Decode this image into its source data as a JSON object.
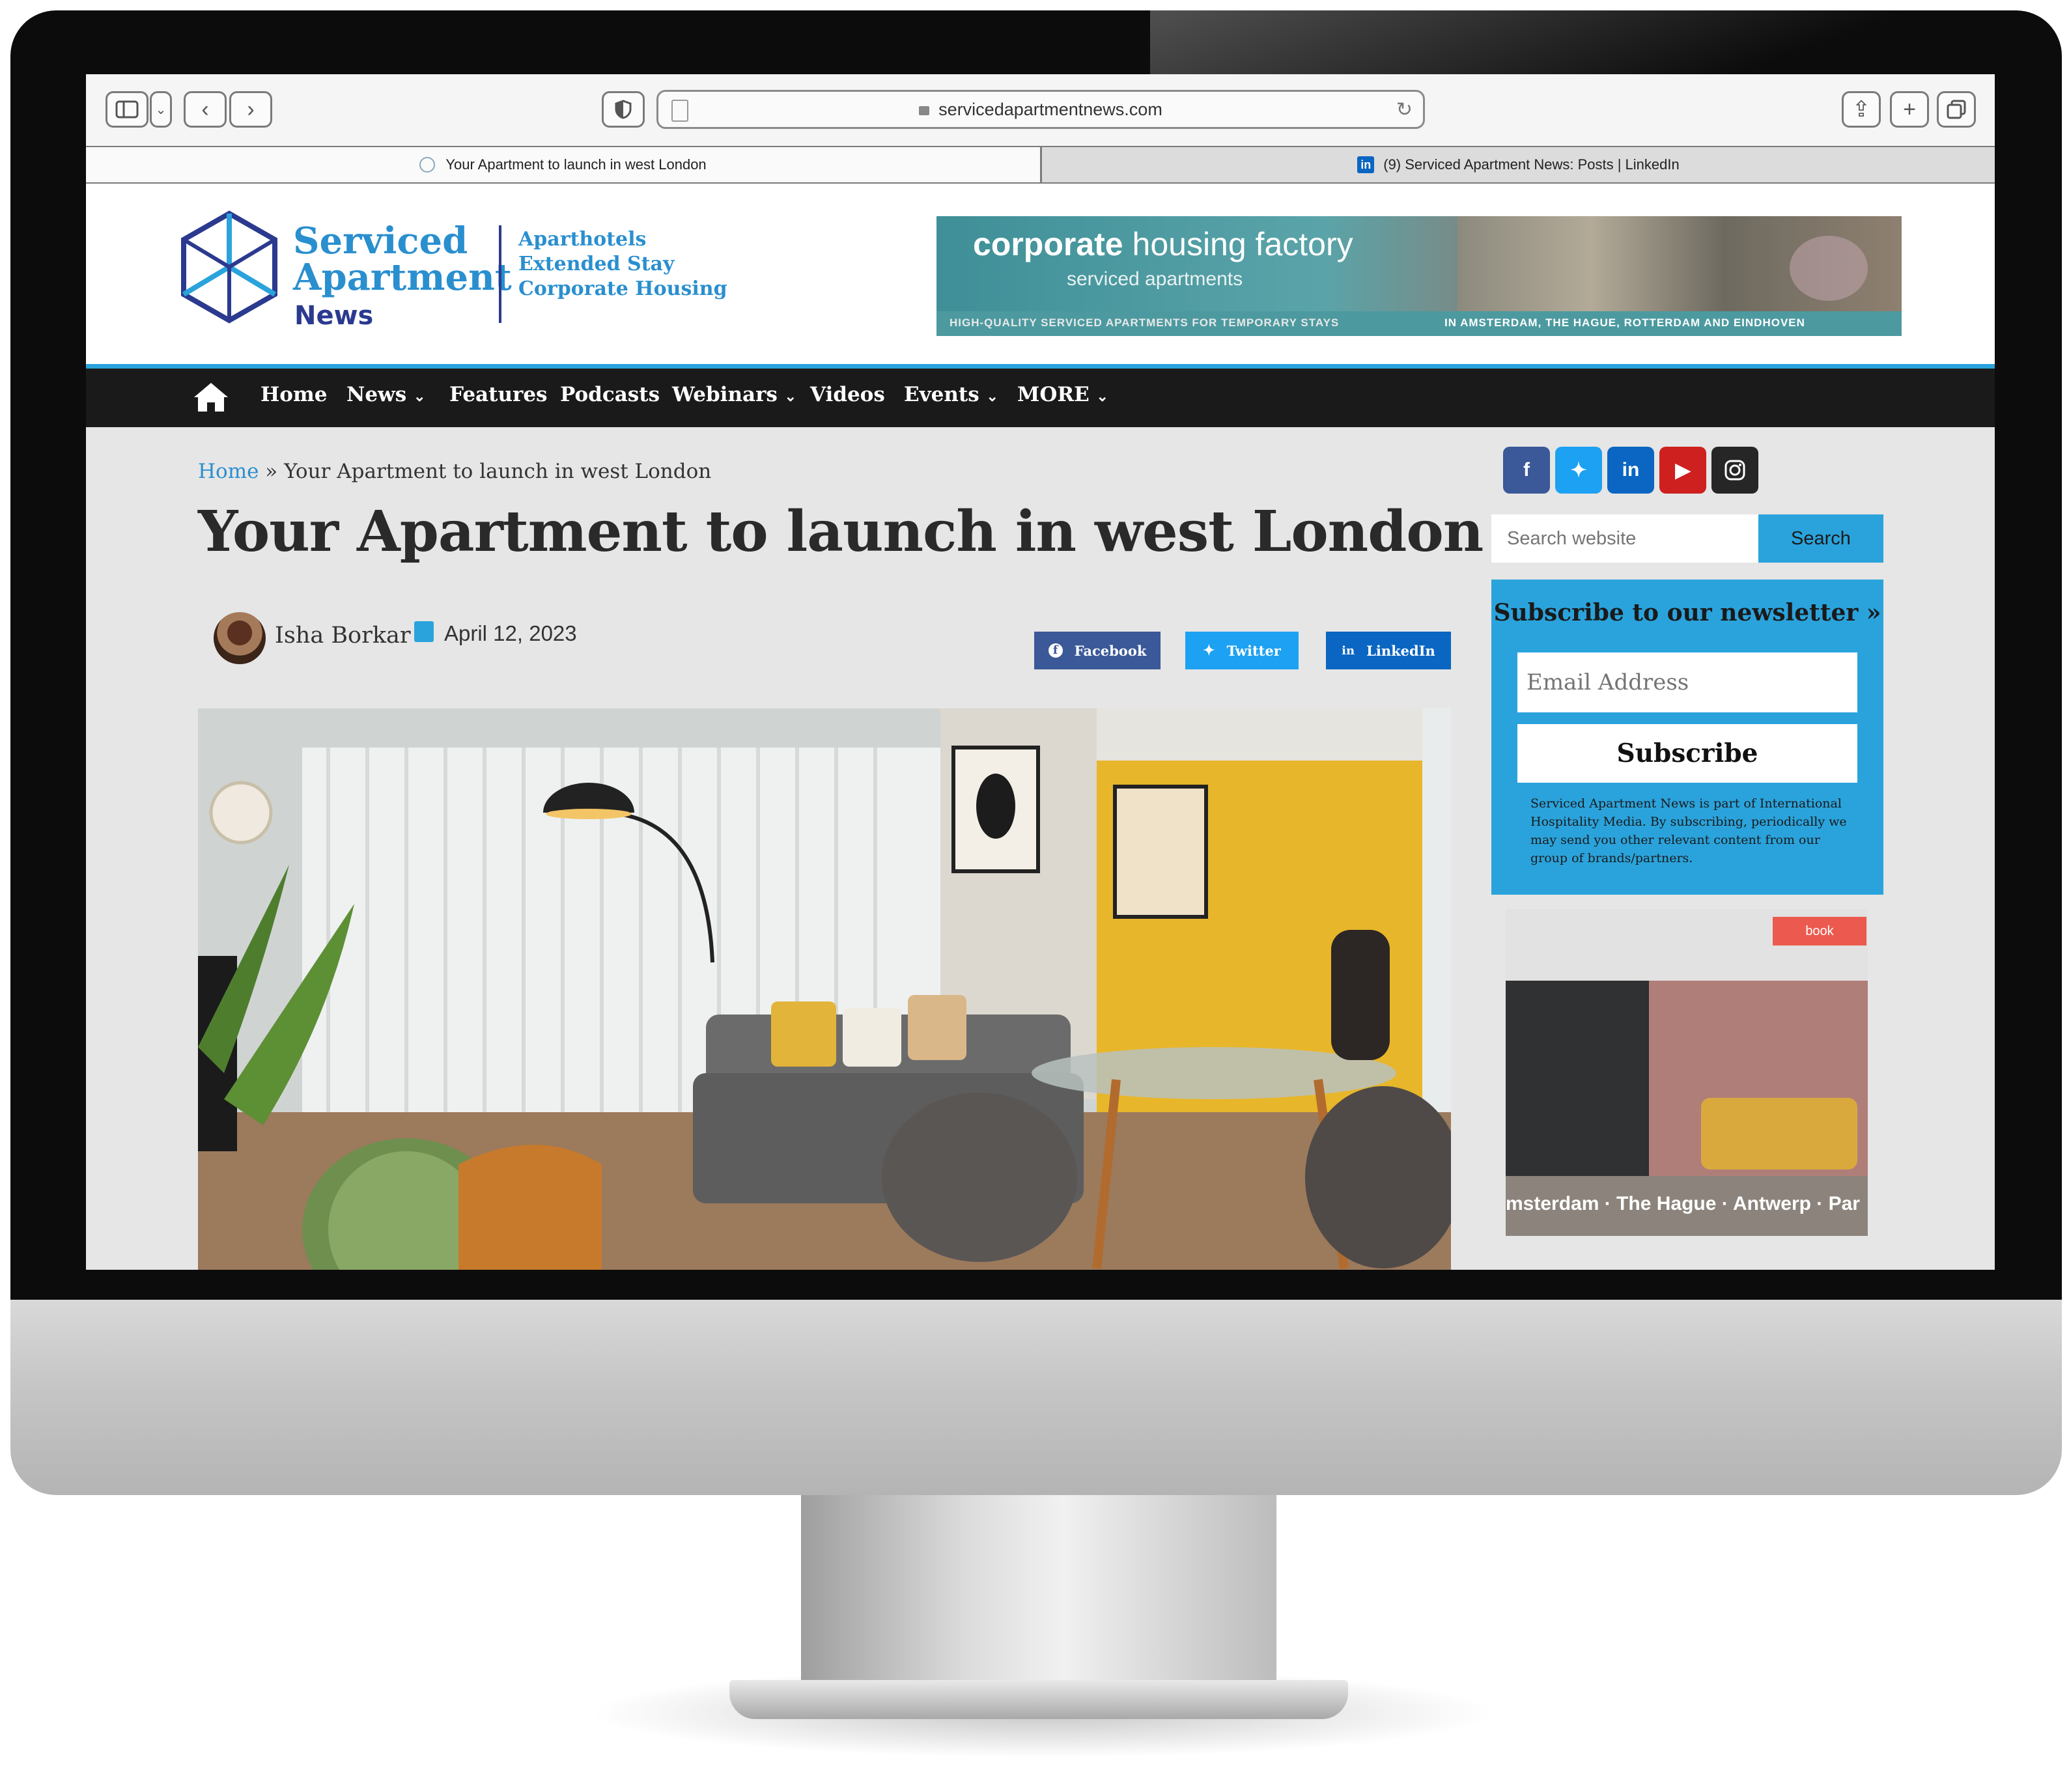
{
  "browser": {
    "url": "servicedapartmentnews.com",
    "tabs": [
      {
        "label": "Your Apartment to launch in west London",
        "active": true
      },
      {
        "label": "(9) Serviced Apartment News: Posts | LinkedIn",
        "active": false
      }
    ]
  },
  "site": {
    "logo": {
      "line1": "Serviced",
      "line2": "Apartment",
      "line3": "News"
    },
    "taglines": [
      "Aparthotels",
      "Extended Stay",
      "Corporate Housing"
    ],
    "banner": {
      "brand_bold": "corporate",
      "brand_light": " housing factory",
      "subtitle": "serviced apartments",
      "strip_left": "HIGH-QUALITY SERVICED APARTMENTS FOR TEMPORARY STAYS",
      "strip_right": "IN AMSTERDAM, THE HAGUE, ROTTERDAM AND EINDHOVEN"
    }
  },
  "nav": {
    "items": [
      "Home",
      "News",
      "Features",
      "Podcasts",
      "Webinars",
      "Videos",
      "Events",
      "MORE"
    ],
    "dropdowns": [
      "News",
      "Webinars",
      "Events",
      "MORE"
    ]
  },
  "article": {
    "breadcrumb_home": "Home",
    "breadcrumb_sep": " » ",
    "breadcrumb_current": "Your Apartment to launch in west London",
    "title": "Your Apartment to launch in west London",
    "author": "Isha Borkar",
    "date": "April 12, 2023",
    "share": {
      "facebook": "Facebook",
      "twitter": "Twitter",
      "linkedin": "LinkedIn"
    }
  },
  "sidebar": {
    "search_placeholder": "Search website",
    "search_button": "Search",
    "newsletter": {
      "title": "Subscribe to our newsletter »",
      "email_placeholder": "Email Address",
      "button": "Subscribe",
      "fine_print": "Serviced Apartment News is part of International Hospitality Media. By subscribing, periodically we may send you other relevant content from our group of brands/partners."
    },
    "ad": {
      "badge": "book",
      "cities": "msterdam · The Hague · Antwerp · Par"
    }
  },
  "colors": {
    "accent": "#2aa3dc",
    "brand_dark": "#2b3a8f",
    "nav_bg": "#1a1a1a",
    "facebook": "#3b5998",
    "twitter": "#1da1f2",
    "linkedin": "#0a66c2",
    "youtube": "#cd201f",
    "instagram": "#262626"
  }
}
